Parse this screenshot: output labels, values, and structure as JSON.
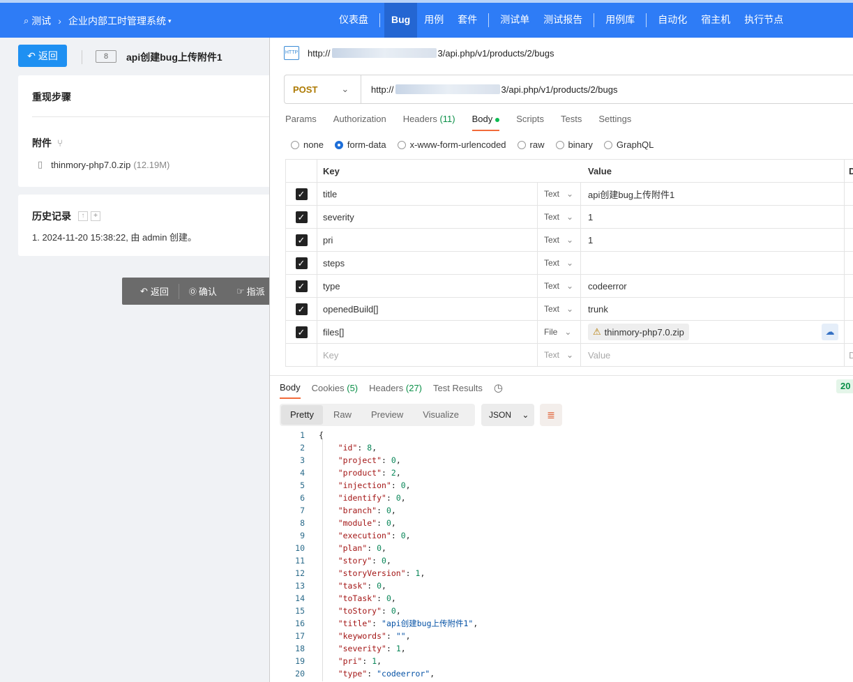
{
  "topbar": {
    "breadcrumb": [
      "测试",
      "企业内部工时管理系统"
    ],
    "nav": [
      "仪表盘",
      "Bug",
      "用例",
      "套件",
      "测试单",
      "测试报告",
      "用例库",
      "自动化",
      "宿主机",
      "执行节点"
    ]
  },
  "bug": {
    "back_label": "返回",
    "id": "8",
    "title": "api创建bug上传附件1",
    "steps_label": "重现步骤",
    "attachments_label": "附件",
    "file_name": "thinmory-php7.0.zip",
    "file_size": "(12.19M)",
    "history_label": "历史记录",
    "history_entry": "1. 2024-11-20 15:38:22, 由 admin 创建。",
    "actions": [
      "返回",
      "确认",
      "指派"
    ]
  },
  "postman": {
    "url_title_prefix": "http://",
    "url_title_suffix": "3/api.php/v1/products/2/bugs",
    "method": "POST",
    "url_prefix": "http://",
    "url_suffix": "3/api.php/v1/products/2/bugs",
    "tabs": [
      {
        "label": "Params"
      },
      {
        "label": "Authorization"
      },
      {
        "label": "Headers",
        "count": "(11)"
      },
      {
        "label": "Body"
      },
      {
        "label": "Scripts"
      },
      {
        "label": "Tests"
      },
      {
        "label": "Settings"
      }
    ],
    "body_types": [
      "none",
      "form-data",
      "x-www-form-urlencoded",
      "raw",
      "binary",
      "GraphQL"
    ],
    "table_headers": {
      "key": "Key",
      "value": "Value",
      "desc": "D"
    },
    "rows": [
      {
        "key": "title",
        "type": "Text",
        "value": "api创建bug上传附件1"
      },
      {
        "key": "severity",
        "type": "Text",
        "value": "1"
      },
      {
        "key": "pri",
        "type": "Text",
        "value": "1"
      },
      {
        "key": "steps",
        "type": "Text",
        "value": ""
      },
      {
        "key": "type",
        "type": "Text",
        "value": "codeerror"
      },
      {
        "key": "openedBuild[]",
        "type": "Text",
        "value": "trunk"
      },
      {
        "key": "files[]",
        "type": "File",
        "value": "thinmory-php7.0.zip"
      }
    ],
    "placeholder_row": {
      "key": "Key",
      "type": "Text",
      "value": "Value",
      "desc": "D"
    },
    "response_tabs": [
      {
        "label": "Body"
      },
      {
        "label": "Cookies",
        "count": "(5)"
      },
      {
        "label": "Headers",
        "count": "(27)"
      },
      {
        "label": "Test Results"
      }
    ],
    "status": "20",
    "view_modes": [
      "Pretty",
      "Raw",
      "Preview",
      "Visualize"
    ],
    "format": "JSON",
    "response_lines": [
      {
        "no": "1",
        "key": "",
        "value": "{",
        "vtype": "p"
      },
      {
        "no": "2",
        "key": "\"id\"",
        "value": "8",
        "vtype": "n"
      },
      {
        "no": "3",
        "key": "\"project\"",
        "value": "0",
        "vtype": "n"
      },
      {
        "no": "4",
        "key": "\"product\"",
        "value": "2",
        "vtype": "n"
      },
      {
        "no": "5",
        "key": "\"injection\"",
        "value": "0",
        "vtype": "n"
      },
      {
        "no": "6",
        "key": "\"identify\"",
        "value": "0",
        "vtype": "n"
      },
      {
        "no": "7",
        "key": "\"branch\"",
        "value": "0",
        "vtype": "n"
      },
      {
        "no": "8",
        "key": "\"module\"",
        "value": "0",
        "vtype": "n"
      },
      {
        "no": "9",
        "key": "\"execution\"",
        "value": "0",
        "vtype": "n"
      },
      {
        "no": "10",
        "key": "\"plan\"",
        "value": "0",
        "vtype": "n"
      },
      {
        "no": "11",
        "key": "\"story\"",
        "value": "0",
        "vtype": "n"
      },
      {
        "no": "12",
        "key": "\"storyVersion\"",
        "value": "1",
        "vtype": "n"
      },
      {
        "no": "13",
        "key": "\"task\"",
        "value": "0",
        "vtype": "n"
      },
      {
        "no": "14",
        "key": "\"toTask\"",
        "value": "0",
        "vtype": "n"
      },
      {
        "no": "15",
        "key": "\"toStory\"",
        "value": "0",
        "vtype": "n"
      },
      {
        "no": "16",
        "key": "\"title\"",
        "value": "\"api创建bug上传附件1\"",
        "vtype": "s"
      },
      {
        "no": "17",
        "key": "\"keywords\"",
        "value": "\"\"",
        "vtype": "s"
      },
      {
        "no": "18",
        "key": "\"severity\"",
        "value": "1",
        "vtype": "n"
      },
      {
        "no": "19",
        "key": "\"pri\"",
        "value": "1",
        "vtype": "n"
      },
      {
        "no": "20",
        "key": "\"type\"",
        "value": "\"codeerror\"",
        "vtype": "s"
      }
    ]
  },
  "colors": {
    "brand": "#2e7cf6",
    "method": "#ad7a03",
    "accent_tab": "#f26b3a",
    "ok_status": "#0a8f47"
  }
}
